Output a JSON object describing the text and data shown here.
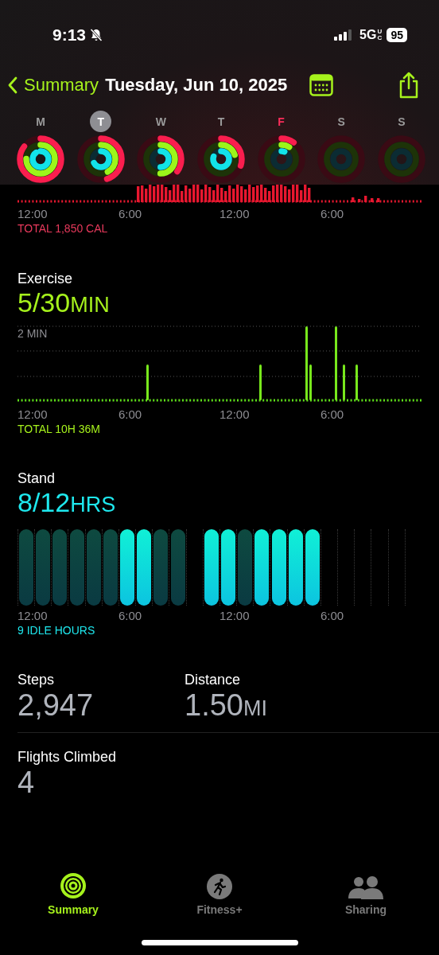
{
  "status_bar": {
    "time": "9:13",
    "silent": true,
    "network": "5G",
    "network_badge": "UC",
    "battery": "95"
  },
  "nav": {
    "back": "Summary",
    "title": "Tuesday, Jun 10, 2025"
  },
  "week": [
    {
      "letter": "M",
      "selected": false,
      "today": false
    },
    {
      "letter": "T",
      "selected": true,
      "today": false
    },
    {
      "letter": "W",
      "selected": false,
      "today": false
    },
    {
      "letter": "T",
      "selected": false,
      "today": false
    },
    {
      "letter": "F",
      "selected": false,
      "today": true
    },
    {
      "letter": "S",
      "selected": false,
      "today": false
    },
    {
      "letter": "S",
      "selected": false,
      "today": false
    }
  ],
  "move": {
    "axis": [
      "12:00",
      "6:00",
      "12:00",
      "6:00"
    ],
    "total": "TOTAL 1,850 CAL"
  },
  "exercise": {
    "title": "Exercise",
    "value": "5/30",
    "unit": "MIN",
    "gridline_label": "2 MIN",
    "axis": [
      "12:00",
      "6:00",
      "12:00",
      "6:00"
    ],
    "total": "TOTAL 10H 36M"
  },
  "stand": {
    "title": "Stand",
    "value": "8/12",
    "unit": "HRS",
    "hours": [
      {
        "kind": "idle"
      },
      {
        "kind": "idle"
      },
      {
        "kind": "idle"
      },
      {
        "kind": "idle"
      },
      {
        "kind": "idle"
      },
      {
        "kind": "idle"
      },
      {
        "kind": "stood"
      },
      {
        "kind": "stood"
      },
      {
        "kind": "idle"
      },
      {
        "kind": "idle"
      },
      {
        "kind": "none"
      },
      {
        "kind": "stood"
      },
      {
        "kind": "stood"
      },
      {
        "kind": "idle"
      },
      {
        "kind": "stood"
      },
      {
        "kind": "stood"
      },
      {
        "kind": "stood"
      },
      {
        "kind": "stood"
      },
      {
        "kind": "none"
      },
      {
        "kind": "none"
      },
      {
        "kind": "none"
      },
      {
        "kind": "none"
      },
      {
        "kind": "none"
      },
      {
        "kind": "none"
      }
    ],
    "axis": [
      "12:00",
      "6:00",
      "12:00",
      "6:00"
    ],
    "total": "9 IDLE HOURS"
  },
  "steps": {
    "label": "Steps",
    "value": "2,947"
  },
  "distance": {
    "label": "Distance",
    "value": "1.50",
    "unit": "MI"
  },
  "flights": {
    "label": "Flights Climbed",
    "value": "4"
  },
  "tabs": [
    {
      "label": "Summary",
      "kind": "summary",
      "selected": true
    },
    {
      "label": "Fitness+",
      "kind": "fitness",
      "selected": false
    },
    {
      "label": "Sharing",
      "kind": "sharing",
      "selected": false
    }
  ]
}
